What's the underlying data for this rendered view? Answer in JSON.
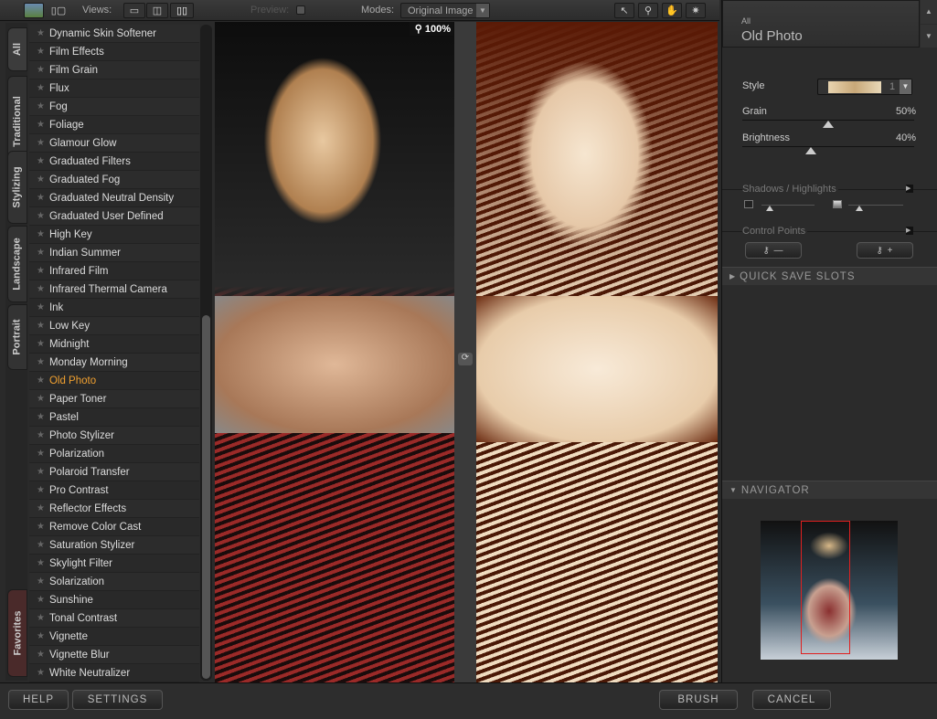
{
  "toolbar": {
    "views_label": "Views:",
    "preview_label": "Preview:",
    "modes_label": "Modes:",
    "mode_value": "Original Image",
    "zoom": "100%"
  },
  "tabs": [
    "All",
    "Traditional",
    "Stylizing",
    "Landscape",
    "Portrait",
    "Favorites"
  ],
  "filters": [
    "Dynamic Skin Softener",
    "Film Effects",
    "Film Grain",
    "Flux",
    "Fog",
    "Foliage",
    "Glamour Glow",
    "Graduated Filters",
    "Graduated Fog",
    "Graduated Neutral Density",
    "Graduated User Defined",
    "High Key",
    "Indian Summer",
    "Infrared Film",
    "Infrared Thermal Camera",
    "Ink",
    "Low Key",
    "Midnight",
    "Monday Morning",
    "Old Photo",
    "Paper Toner",
    "Pastel",
    "Photo Stylizer",
    "Polarization",
    "Polaroid Transfer",
    "Pro Contrast",
    "Reflector Effects",
    "Remove Color Cast",
    "Saturation Stylizer",
    "Skylight Filter",
    "Solarization",
    "Sunshine",
    "Tonal Contrast",
    "Vignette",
    "Vignette Blur",
    "White Neutralizer"
  ],
  "selected_filter": "Old Photo",
  "panel": {
    "category": "All",
    "title": "Old Photo",
    "style_label": "Style",
    "style_value": "1",
    "grain_label": "Grain",
    "grain_value": "50%",
    "grain": 50,
    "brightness_label": "Brightness",
    "brightness_value": "40%",
    "brightness": 40,
    "shadows_label": "Shadows / Highlights",
    "control_points_label": "Control Points",
    "quick_save": "QUICK SAVE SLOTS",
    "navigator": "NAVIGATOR"
  },
  "bottom": {
    "help": "HELP",
    "settings": "SETTINGS",
    "brush": "BRUSH",
    "cancel": "CANCEL"
  },
  "colors": {
    "accent": "#f0a030",
    "background": "#2a2a2a"
  }
}
